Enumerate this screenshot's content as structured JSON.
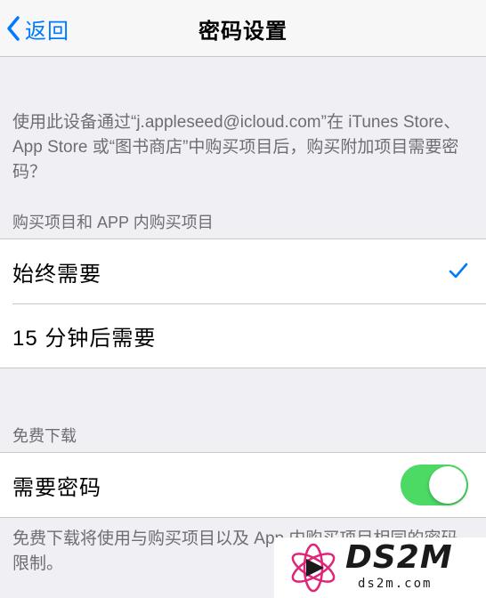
{
  "nav": {
    "back_label": "返回",
    "title": "密码设置"
  },
  "description": "使用此设备通过“j.appleseed@icloud.com”在 iTunes Store、App Store 或“图书商店”中购买项目后，购买附加项目需要密码？",
  "purchases_section": {
    "header": "购买项目和 APP 内购买项目",
    "options": [
      {
        "label": "始终需要",
        "selected": true
      },
      {
        "label": "15 分钟后需要",
        "selected": false
      }
    ]
  },
  "free_downloads_section": {
    "header": "免费下载",
    "toggle_label": "需要密码",
    "toggle_on": true,
    "footer": "免费下载将使用与购买项目以及 App 内购买项目相同的密码限制。"
  },
  "colors": {
    "accent": "#007aff",
    "toggle_on": "#4cd964",
    "background": "#efeff4"
  },
  "watermark": {
    "brand": "DS2M",
    "url": "ds2m.com"
  }
}
